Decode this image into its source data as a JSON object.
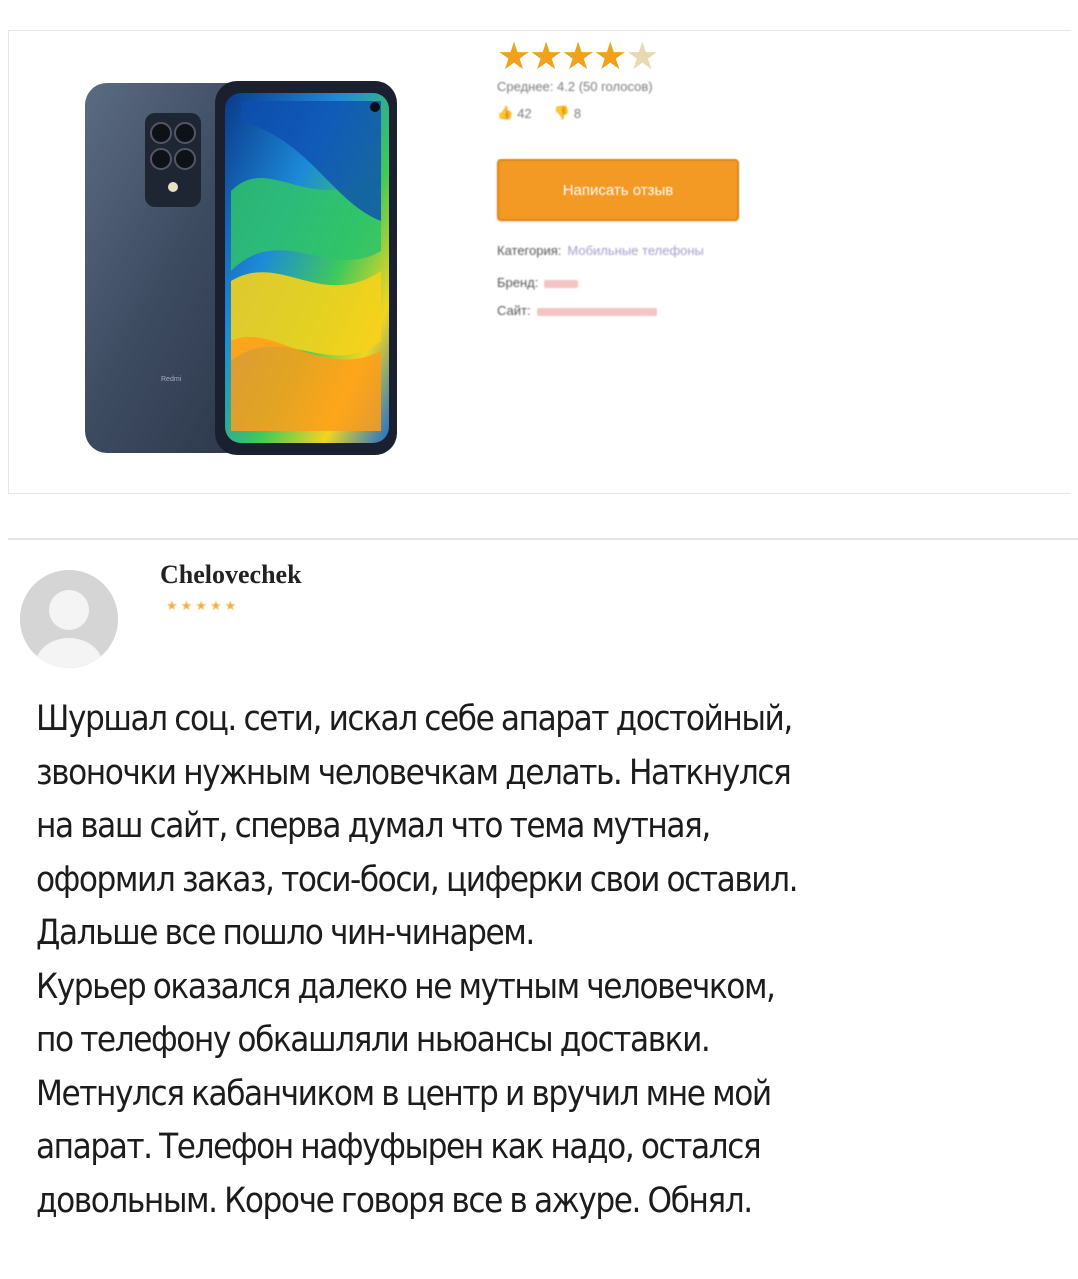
{
  "product": {
    "rating_stars": 4,
    "rating_max": 5,
    "average_text": "Среднее: 4.2  (50 голосов)",
    "likes": "42",
    "dislikes": "8",
    "write_review_label": "Написать отзыв",
    "category_label": "Категория:",
    "category_value": "Мобильные телефоны",
    "brand_label": "Бренд:",
    "site_label": "Сайт:",
    "phone_brand_text": "Redmi"
  },
  "review": {
    "author": "Chelovechek",
    "stars_text": "★★★★★",
    "lines": [
      "Шуршал соц. сети, искал себе апарат достойный,",
      "звоночки нужным человечкам делать. Наткнулся",
      "на ваш сайт, сперва думал что тема мутная,",
      "оформил заказ, тоси-боси, циферки свои оставил.",
      "Дальше все пошло чин-чинарем.",
      "Курьер оказался далеко не мутным человечком,",
      "по телефону обкашляли ньюансы доставки.",
      "Метнулся кабанчиком в центр и вручил мне мой",
      "апарат. Телефон нафуфырен как надо, остался",
      "довольным. Короче говоря все в ажуре. Обнял."
    ]
  },
  "colors": {
    "accent_orange": "#f39a24",
    "star_gold": "#f0a21e"
  }
}
